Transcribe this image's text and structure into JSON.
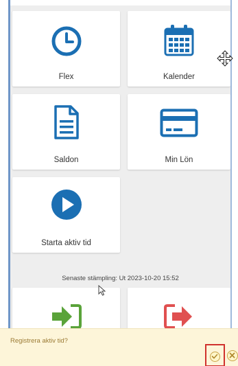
{
  "tiles": [
    {
      "label": "Flex",
      "icon": "clock-icon"
    },
    {
      "label": "Kalender",
      "icon": "calendar-icon"
    },
    {
      "label": "Saldon",
      "icon": "document-icon"
    },
    {
      "label": "Min Lön",
      "icon": "credit-card-icon"
    },
    {
      "label": "Starta aktiv tid",
      "icon": "play-icon"
    },
    {
      "label": "",
      "icon": "sign-in-icon"
    },
    {
      "label": "",
      "icon": "sign-out-icon"
    }
  ],
  "status": {
    "last_stamp": "Senaste stämpling: Ut 2023-10-20 15:52"
  },
  "prompt_bar": {
    "question": "Registrera aktiv tid?",
    "confirm_icon": "check-icon",
    "cancel_icon": "close-icon"
  },
  "colors": {
    "accent_blue": "#1b6fb3",
    "sign_in_green": "#5aa33a",
    "sign_out_red": "#e05050",
    "prompt_text": "#9b7b35",
    "highlight_red": "#d0312d"
  }
}
